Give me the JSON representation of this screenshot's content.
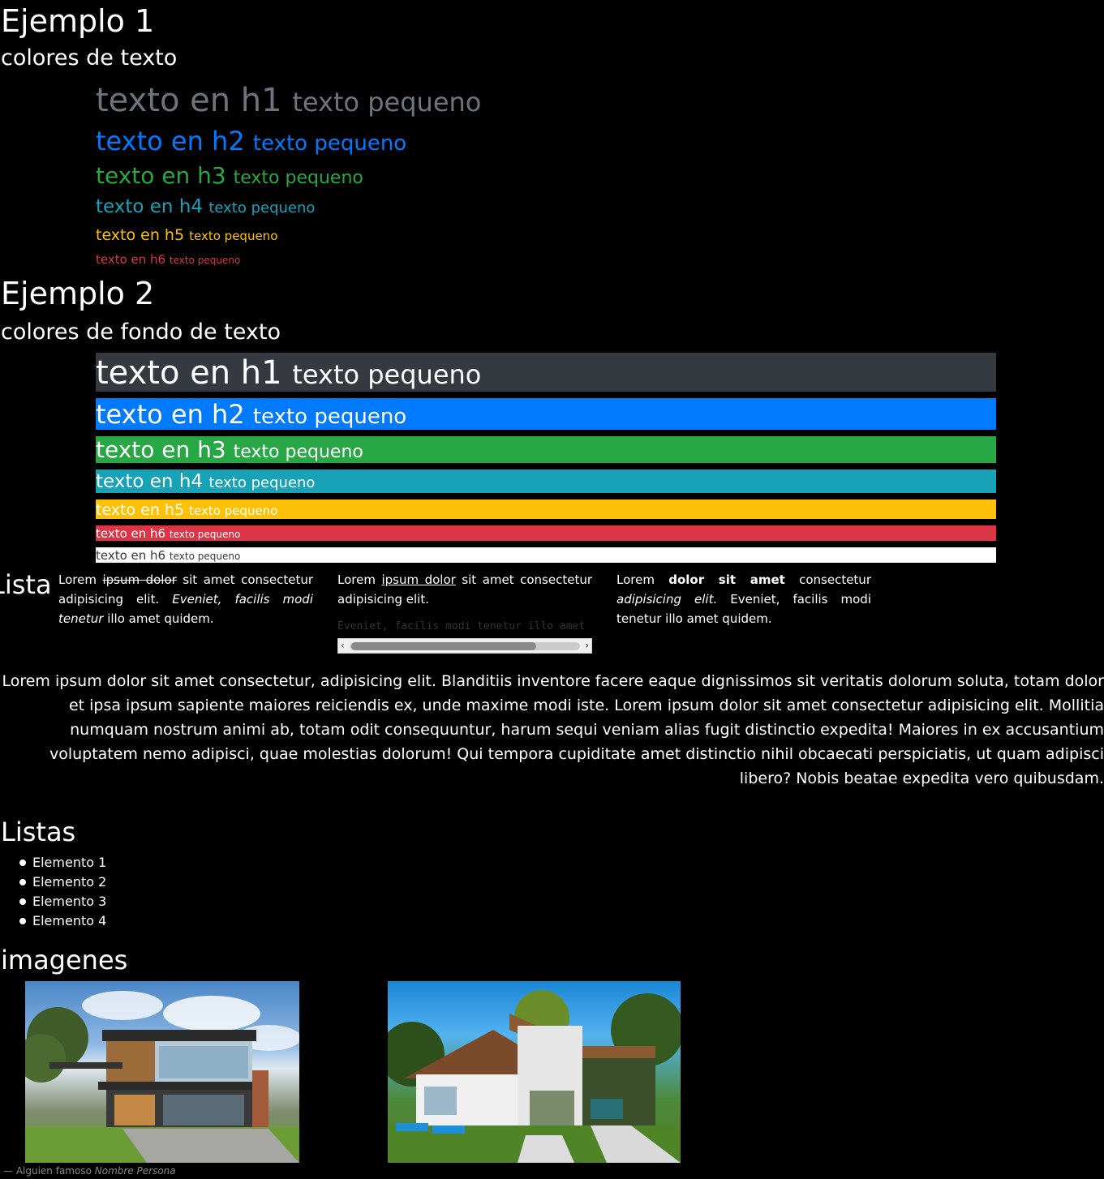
{
  "example1": {
    "title": "Ejemplo 1",
    "subtitle": "colores de texto",
    "rows": [
      {
        "heading": "texto en h1",
        "small": "texto pequeno",
        "color": "#6c757d"
      },
      {
        "heading": "texto en h2",
        "small": "texto pequeno",
        "color": "#007bff"
      },
      {
        "heading": "texto en h3",
        "small": "texto pequeno",
        "color": "#28a745"
      },
      {
        "heading": "texto en h4",
        "small": "texto pequeno",
        "color": "#17a2b8"
      },
      {
        "heading": "texto en h5",
        "small": "texto pequeno",
        "color": "#ffc107"
      },
      {
        "heading": "texto en h6",
        "small": "texto pequeno",
        "color": "#dc3545"
      }
    ]
  },
  "example2": {
    "title": "Ejemplo 2",
    "subtitle": "colores de fondo de texto",
    "rows": [
      {
        "heading": "texto en h1",
        "small": "texto pequeno",
        "bg": "#343a40",
        "color": "#ffffff"
      },
      {
        "heading": "texto en h2",
        "small": "texto pequeno",
        "bg": "#007bff",
        "color": "#ffffff"
      },
      {
        "heading": "texto en h3",
        "small": "texto pequeno",
        "bg": "#28a745",
        "color": "#ffffff"
      },
      {
        "heading": "texto en h4",
        "small": "texto pequeno",
        "bg": "#17a2b8",
        "color": "#ffffff"
      },
      {
        "heading": "texto en h5",
        "small": "texto pequeno",
        "bg": "#ffc107",
        "color": "#ffffff"
      },
      {
        "heading": "texto en h6",
        "small": "texto pequeno",
        "bg": "#dc3545",
        "color": "#ffffff"
      },
      {
        "heading": "texto en h6",
        "small": "texto pequeno",
        "bg": "#ffffff",
        "color": "#343a40"
      }
    ]
  },
  "lista_section": {
    "title": "Lista",
    "col1": {
      "t1": "Lorem",
      "strike": "ipsum dolor",
      "t2": "sit amet consectetur adipisicing elit.",
      "italic": "Eveniet, facilis modi tenetur",
      "t3": "illo amet quidem."
    },
    "col2": {
      "t1": "Lorem",
      "underline": "ipsum dolor",
      "t2": "sit amet consectetur adipisicing elit.",
      "code": "Eveniet, facilis modi tenetur illo amet quidem."
    },
    "col3": {
      "t1": "Lorem",
      "bold": "dolor sit amet",
      "t2": "consectetur",
      "italic": "adipisicing elit.",
      "t3": "Eveniet, facilis modi tenetur illo amet quidem."
    }
  },
  "paragraph": "Lorem ipsum dolor sit amet consectetur, adipisicing elit. Blanditiis inventore facere eaque dignissimos sit veritatis dolorum soluta, totam dolor et ipsa ipsum sapiente maiores reiciendis ex, unde maxime modi iste. Lorem ipsum dolor sit amet consectetur adipisicing elit. Mollitia numquam nostrum animi ab, totam odit consequuntur, harum sequi veniam alias fugit distinctio expedita! Maiores in ex accusantium voluptatem nemo adipisci, quae molestias dolorum! Qui tempora cupiditate amet distinctio nihil obcaecati perspiciatis, ut quam adipisci libero? Nobis beatae expedita vero quibusdam.",
  "listas": {
    "title": "Listas",
    "items": [
      "Elemento 1",
      "Elemento 2",
      "Elemento 3",
      "Elemento 4"
    ]
  },
  "imagenes": {
    "title": "imagenes",
    "caption_prefix": "— ",
    "caption_text": "Alguien famoso",
    "caption_cite": "Nombre Persona"
  }
}
